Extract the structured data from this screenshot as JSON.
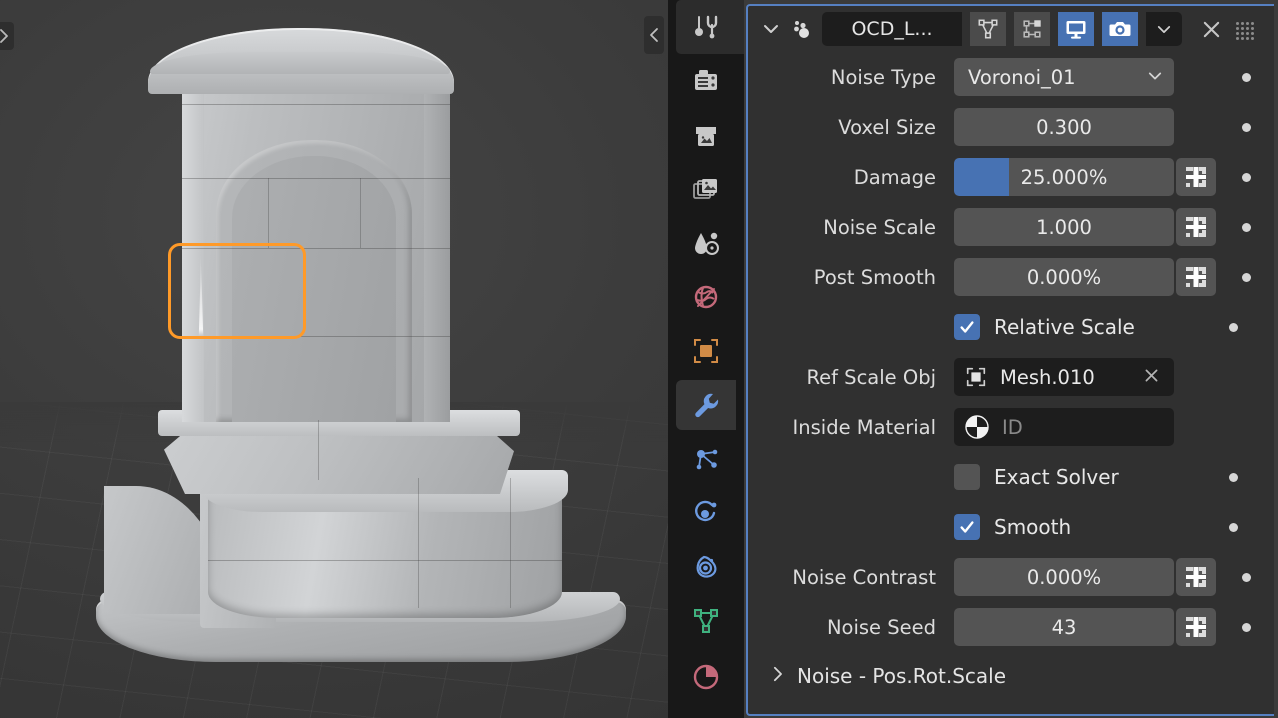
{
  "viewport": {
    "name": "3d-viewport",
    "left_toggle_icon": "chevron-right-icon",
    "right_toggle_icon": "chevron-left-icon",
    "selection_color": "#ff9a28",
    "background_color": "#3c3c3c",
    "model_description": "Shaded stone wall fountain with arched top, basin and oval base"
  },
  "tab_strip": {
    "items": [
      {
        "name": "tool",
        "icon": "tool-icon",
        "color": "#c8c8c8",
        "state": "active-tool"
      },
      {
        "name": "render",
        "icon": "camera-back-icon",
        "color": "#c8c8c8",
        "state": "normal"
      },
      {
        "name": "output",
        "icon": "printer-icon",
        "color": "#c8c8c8",
        "state": "normal"
      },
      {
        "name": "view-layer",
        "icon": "images-icon",
        "color": "#c8c8c8",
        "state": "normal"
      },
      {
        "name": "scene",
        "icon": "scene-cone-icon",
        "color": "#c8c8c8",
        "state": "normal"
      },
      {
        "name": "world",
        "icon": "world-globe-icon",
        "color": "#c4697a",
        "state": "normal"
      },
      {
        "name": "object",
        "icon": "object-square-icon",
        "color": "#d18b46",
        "state": "normal"
      },
      {
        "name": "modifiers",
        "icon": "wrench-icon",
        "color": "#6c9ae0",
        "state": "active"
      },
      {
        "name": "particles",
        "icon": "particles-icon",
        "color": "#6c9ae0",
        "state": "normal"
      },
      {
        "name": "physics",
        "icon": "physics-orbit-icon",
        "color": "#6c9ae0",
        "state": "normal"
      },
      {
        "name": "constraints",
        "icon": "constraint-icon",
        "color": "#6c9ae0",
        "state": "normal"
      },
      {
        "name": "data",
        "icon": "mesh-data-triangle-icon",
        "color": "#3fb27f",
        "state": "normal"
      },
      {
        "name": "material",
        "icon": "material-sphere-icon",
        "color": "#c4697a",
        "state": "normal"
      }
    ]
  },
  "modifier": {
    "header": {
      "expand_icon": "chevron-down-icon",
      "type_icon": "remesh-dots-icon",
      "name": "OCD_L...",
      "toggles": [
        {
          "name": "show-in-edit-mode-cage",
          "icon": "vertex-triangle-icon",
          "on": false
        },
        {
          "name": "show-in-edit-mode",
          "icon": "edit-mode-icon",
          "on": false
        },
        {
          "name": "show-in-viewport",
          "icon": "display-monitor-icon",
          "on": true
        },
        {
          "name": "show-in-render",
          "icon": "camera-icon",
          "on": true
        }
      ],
      "dropdown_icon": "chevron-down-icon",
      "close_icon": "close-x-icon",
      "drag_icon": "drag-dots-icon"
    },
    "rows": [
      {
        "kind": "dropdown",
        "label": "Noise Type",
        "value": "Voronoi_01",
        "name": "noise-type",
        "decorator": true
      },
      {
        "kind": "value",
        "label": "Voxel Size",
        "value": "0.300",
        "name": "voxel-size",
        "library": false,
        "decorator": true
      },
      {
        "kind": "slider",
        "label": "Damage",
        "value": "25.000%",
        "fill_percent": 25,
        "name": "damage",
        "library": true,
        "decorator": true
      },
      {
        "kind": "value",
        "label": "Noise Scale",
        "value": "1.000",
        "name": "noise-scale",
        "library": true,
        "decorator": true
      },
      {
        "kind": "value",
        "label": "Post Smooth",
        "value": "0.000%",
        "name": "post-smooth",
        "library": true,
        "decorator": true
      },
      {
        "kind": "checkbox",
        "label": "Relative Scale",
        "checked": true,
        "name": "relative-scale",
        "decorator": true
      },
      {
        "kind": "id",
        "label": "Ref Scale Obj",
        "value": "Mesh.010",
        "placeholder": "",
        "icon": "object-outline-icon",
        "clear_icon": "close-x-icon",
        "name": "ref-scale-obj",
        "decorator": false
      },
      {
        "kind": "id",
        "label": "Inside Material",
        "value": "",
        "placeholder": "ID",
        "icon": "material-sphere-icon",
        "clear_icon": "",
        "name": "inside-material",
        "decorator": false
      },
      {
        "kind": "checkbox",
        "label": "Exact Solver",
        "checked": false,
        "name": "exact-solver",
        "decorator": true
      },
      {
        "kind": "checkbox",
        "label": "Smooth",
        "checked": true,
        "name": "smooth",
        "decorator": true
      },
      {
        "kind": "value",
        "label": "Noise Contrast",
        "value": "0.000%",
        "name": "noise-contrast",
        "library": true,
        "decorator": true
      },
      {
        "kind": "value",
        "label": "Noise Seed",
        "value": "43",
        "name": "noise-seed",
        "library": true,
        "decorator": true
      }
    ],
    "subpanel": {
      "caret_icon": "chevron-right-icon",
      "label": "Noise  -  Pos.Rot.Scale",
      "name": "noise-pos-rot-scale"
    }
  },
  "theme": {
    "accent_blue": "#4772b3",
    "panel_bg": "#303030",
    "field_bg": "#545454",
    "id_field_bg": "#1d1d1d",
    "tab_strip_bg": "#181818",
    "border_highlight": "#5680c2"
  }
}
